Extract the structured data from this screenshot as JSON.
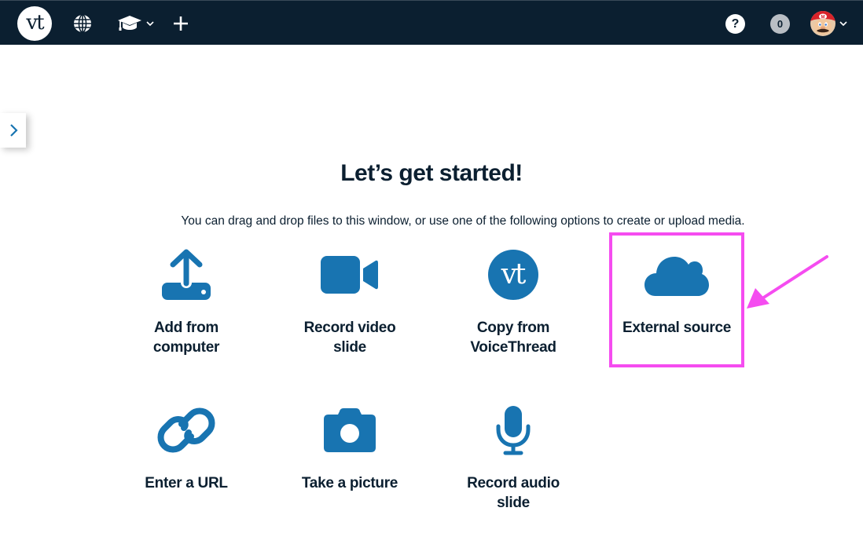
{
  "header": {
    "logo_text": "vt",
    "icons": {
      "globe": "globe-icon",
      "courses": "graduation-cap-icon",
      "create": "plus-icon",
      "help": "question-icon",
      "avatar": "user-avatar"
    },
    "help_label": "?",
    "notification_count": "0"
  },
  "sidebar_toggle": {
    "icon": "chevron-right-icon"
  },
  "main": {
    "title": "Let’s get started!",
    "subtitle": "You can drag and drop files to this window, or use one of the following options to create or upload media.",
    "options": [
      {
        "label": "Add from computer",
        "icon": "upload-icon"
      },
      {
        "label": "Record video slide",
        "icon": "video-camera-icon"
      },
      {
        "label": "Copy from VoiceThread",
        "icon": "voicethread-logo-icon"
      },
      {
        "label": "External source",
        "icon": "cloud-icon"
      },
      {
        "label": "Enter a URL",
        "icon": "link-icon"
      },
      {
        "label": "Take a picture",
        "icon": "camera-icon"
      },
      {
        "label": "Record audio slide",
        "icon": "microphone-icon"
      }
    ],
    "vt_icon_text": "vt"
  },
  "annotation": {
    "highlighted_option": "External source",
    "color": "#f54cf0"
  },
  "colors": {
    "header_bg": "#0b1f30",
    "icon_blue": "#1874b1",
    "text_dark": "#0b1f30"
  }
}
